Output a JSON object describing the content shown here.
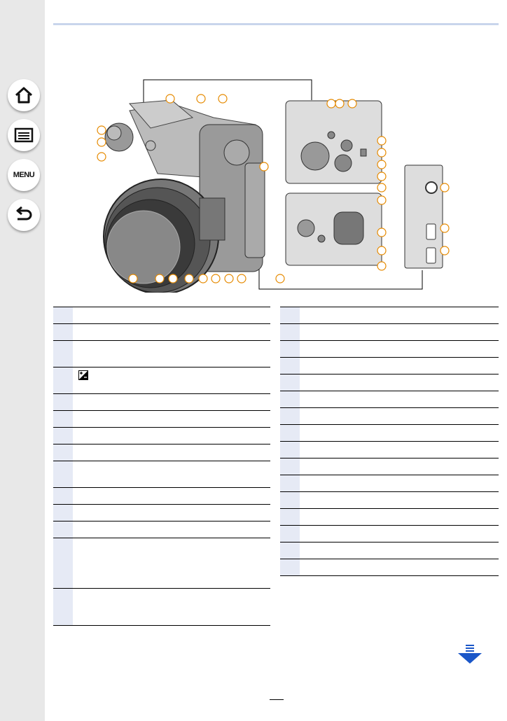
{
  "nav": {
    "home_icon": "home-icon",
    "toc_icon": "table-of-contents-icon",
    "menu_label": "MENU",
    "back_icon": "return-arrow-icon"
  },
  "colors": {
    "sidebar": "#e8e8e8",
    "header_line": "#c9d5ec",
    "table_number_cell": "#e6eaf5",
    "next_arrow": "#1a56c8"
  },
  "left_table": {
    "rows": [
      {
        "text": ""
      },
      {
        "text": ""
      },
      {
        "text": ""
      },
      {
        "text": ""
      },
      {
        "text": ""
      },
      {
        "text": ""
      },
      {
        "text": ""
      },
      {
        "text": ""
      },
      {
        "text": ""
      },
      {
        "text": ""
      },
      {
        "text": ""
      },
      {
        "text": ""
      },
      {
        "text": ""
      },
      {
        "text": ""
      }
    ]
  },
  "right_table": {
    "rows": [
      {
        "text": ""
      },
      {
        "text": ""
      },
      {
        "text": ""
      },
      {
        "text": ""
      },
      {
        "text": ""
      },
      {
        "text": ""
      },
      {
        "text": ""
      },
      {
        "text": ""
      },
      {
        "text": ""
      },
      {
        "text": ""
      },
      {
        "text": ""
      },
      {
        "text": ""
      },
      {
        "text": ""
      },
      {
        "text": ""
      },
      {
        "text": ""
      },
      {
        "text": ""
      }
    ]
  },
  "exposure_icon": "exposure-compensation-icon",
  "next_page_icon": "next-page-arrow-icon",
  "page_number": ""
}
